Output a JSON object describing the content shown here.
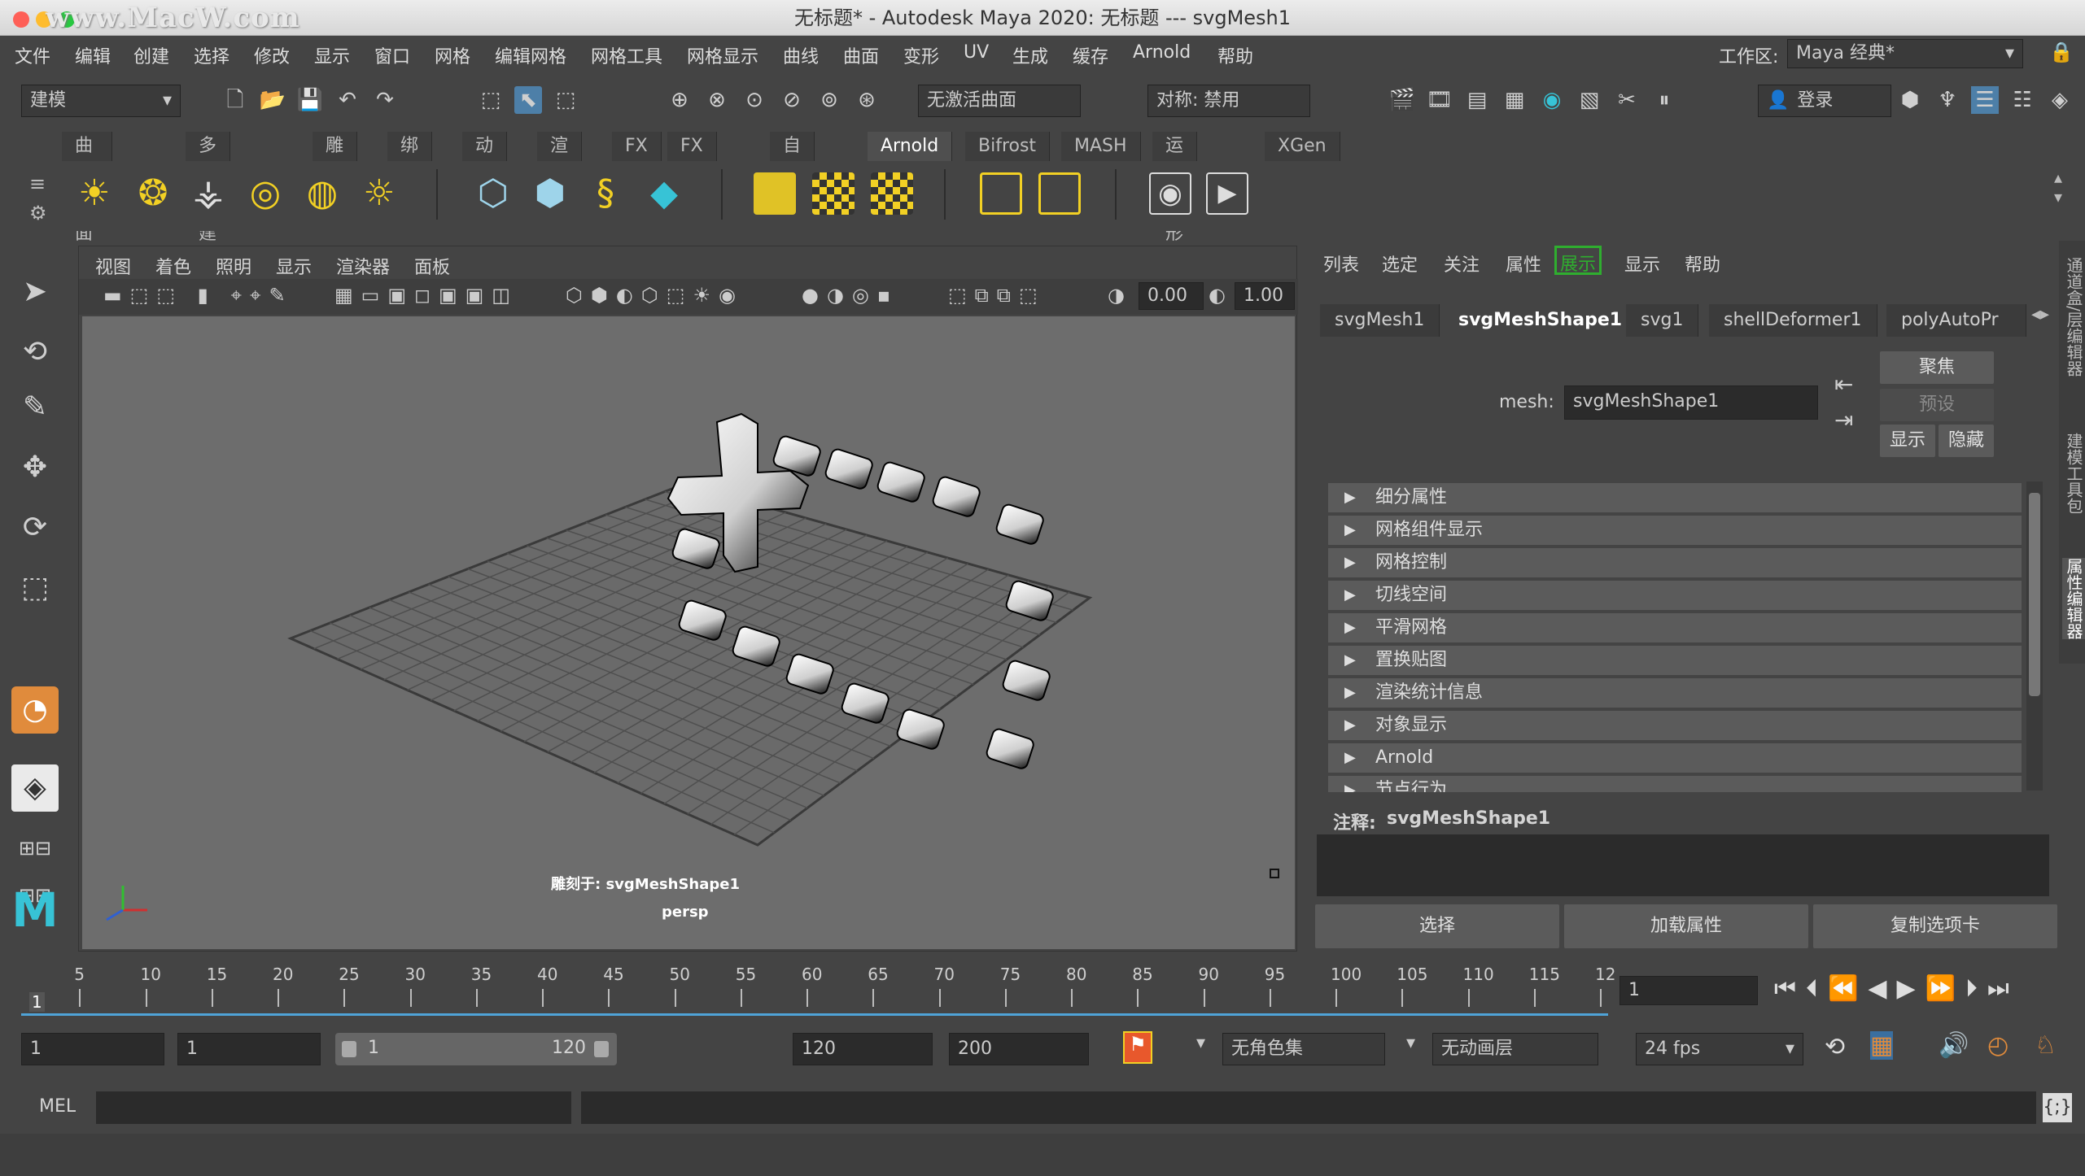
{
  "window": {
    "title": "无标题* - Autodesk Maya 2020: 无标题   ---   svgMesh1",
    "watermark": "www.MacW.com"
  },
  "menubar": {
    "items": [
      "文件",
      "编辑",
      "创建",
      "选择",
      "修改",
      "显示",
      "窗口",
      "网格",
      "编辑网格",
      "网格工具",
      "网格显示",
      "曲线",
      "曲面",
      "变形",
      "UV",
      "生成",
      "缓存",
      "Arnold",
      "帮助"
    ],
    "workspace_label": "工作区:",
    "workspace_value": "Maya 经典*"
  },
  "toolbar": {
    "mode": "建模",
    "live_surface": "无激活曲面",
    "symmetry": "对称: 禁用",
    "login": "登录"
  },
  "shelf": {
    "tabs": [
      "曲线/曲面",
      "多边形建模",
      "雕刻",
      "绑定",
      "动画",
      "渲染",
      "FX",
      "FX 缓存",
      "自定义",
      "Arnold",
      "Bifrost",
      "MASH",
      "运动图形",
      "XGen"
    ],
    "active": "Arnold"
  },
  "viewport": {
    "menus": [
      "视图",
      "着色",
      "照明",
      "显示",
      "渲染器",
      "面板"
    ],
    "exposure": "0.00",
    "gamma": "1.00",
    "camera_label": "persp",
    "sculpt_label": "雕刻于: svgMeshShape1"
  },
  "attr_editor": {
    "menus": [
      "列表",
      "选定",
      "关注",
      "属性",
      "展示",
      "显示",
      "帮助"
    ],
    "tabs": [
      "svgMesh1",
      "svgMeshShape1",
      "svg1",
      "shellDeformer1",
      "polyAutoPr"
    ],
    "mesh_label": "mesh:",
    "mesh_value": "svgMeshShape1",
    "focus": "聚焦",
    "preset": "预设",
    "show": "显示",
    "hide": "隐藏",
    "sections": [
      "细分属性",
      "网格组件显示",
      "网格控制",
      "切线空间",
      "平滑网格",
      "置换贴图",
      "渲染统计信息",
      "对象显示",
      "Arnold",
      "节点行为"
    ],
    "notes_label": "注释:",
    "notes_value": "svgMeshShape1",
    "select": "选择",
    "load_attr": "加载属性",
    "copy_tab": "复制选项卡"
  },
  "right_strip": [
    "通道盒/层编辑器",
    "建模工具包",
    "属性编辑器"
  ],
  "timeline": {
    "ticks": [
      "5",
      "10",
      "15",
      "20",
      "25",
      "30",
      "35",
      "40",
      "45",
      "50",
      "55",
      "60",
      "65",
      "70",
      "75",
      "80",
      "85",
      "90",
      "95",
      "100",
      "105",
      "110",
      "115",
      "12"
    ],
    "current": "1",
    "frame_field": "1"
  },
  "range": {
    "start": "1",
    "anim_start": "1",
    "slider_start": "1",
    "slider_end": "120",
    "end": "120",
    "anim_end": "200",
    "char_set": "无角色集",
    "anim_layer": "无动画层",
    "fps": "24 fps"
  },
  "command": {
    "lang": "MEL"
  }
}
